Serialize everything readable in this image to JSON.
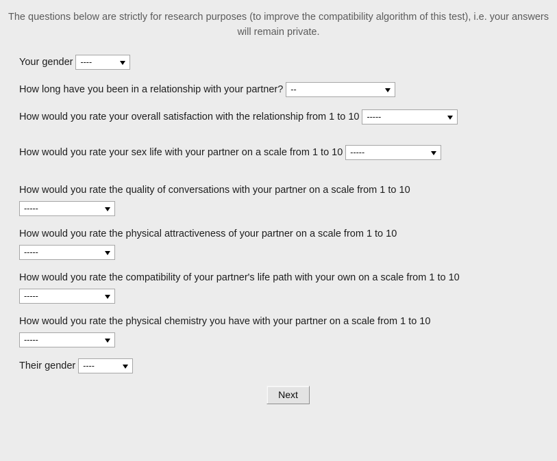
{
  "intro": {
    "text": "The questions below are strictly for research purposes (to improve the compatibility algorithm of this test), i.e. your answers will remain private."
  },
  "form": {
    "questions": [
      {
        "label": "Your gender",
        "value": "----",
        "layout": "inline",
        "size": "xs"
      },
      {
        "label": "How long have you been in a relationship with your partner?",
        "value": "--",
        "layout": "inline",
        "size": "lg"
      },
      {
        "label": "How would you rate your overall satisfaction with the relationship from 1 to 10",
        "value": "-----",
        "layout": "inline",
        "size": "md"
      },
      {
        "label": "How would you rate your sex life with your partner on a scale from 1 to 10",
        "value": "-----",
        "layout": "inline",
        "size": "md"
      },
      {
        "label": "How would you rate the quality of conversations with your partner on a scale from 1 to 10",
        "value": "-----",
        "layout": "wrapped",
        "size": "md"
      },
      {
        "label": "How would you rate the physical attractiveness of your partner on a scale from 1 to 10",
        "value": "-----",
        "layout": "wrapped",
        "size": "md"
      },
      {
        "label": "How would you rate the compatibility of your partner's life path with your own on a scale from 1 to 10",
        "value": "-----",
        "layout": "wrapped",
        "size": "md"
      },
      {
        "label": "How would you rate the physical chemistry you have with your partner on a scale from 1 to 10",
        "value": "-----",
        "layout": "wrapped",
        "size": "md"
      },
      {
        "label": "Their gender",
        "value": "----",
        "layout": "inline",
        "size": "xs"
      }
    ],
    "submit_label": "Next"
  },
  "colors": {
    "background": "#ececec",
    "intro_text": "#5b5b5b",
    "label_text": "#1c1c1c",
    "field_border": "#a6a6a6",
    "field_background": "#ffffff",
    "button_background": "#e3e3e3"
  }
}
